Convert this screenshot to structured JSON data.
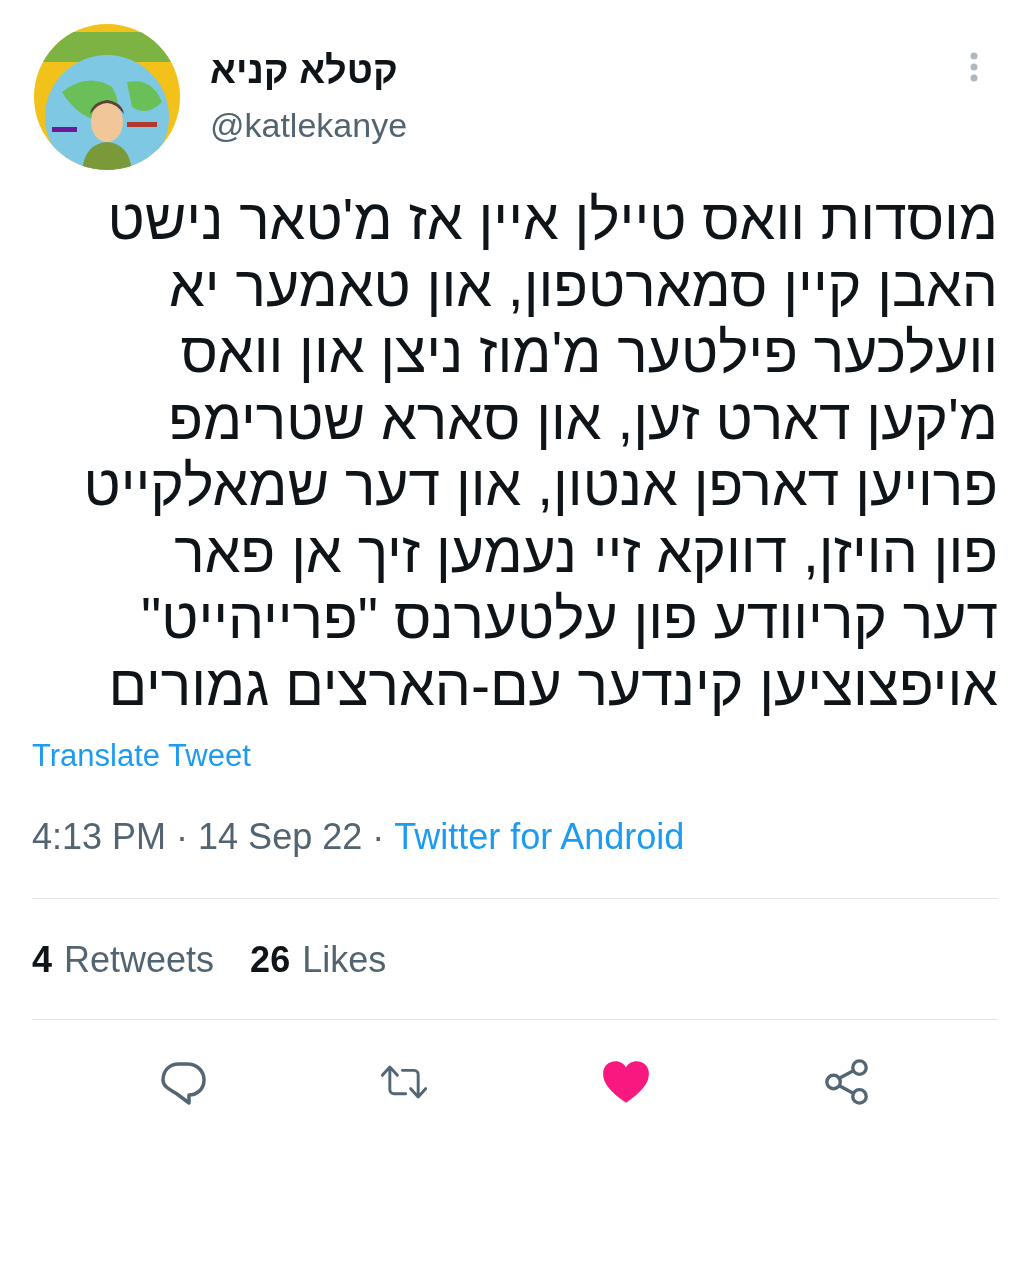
{
  "author": {
    "name": "קטלא קניא",
    "handle": "@katlekanye"
  },
  "tweet": {
    "lines": [
      "מוסדות וואס טיילן איין אז מ'טאר נישט",
      "האבן קיין סמארטפון, און טאמער יא",
      "וועלכער פילטער מ'מוז ניצן און וואס",
      "מ'קען דארט זען, און סארא שטרימפ",
      "פרויען דארפן אנטון, און דער שמאלקייט",
      "פון הויזן, דווקא זיי נעמען זיך אן פאר",
      "דער קריוודע פון עלטערנס \"פרייהייט\"",
      "אויפצוציען קינדער עם-הארצים גמורים"
    ],
    "translate": "Translate Tweet",
    "separator": "·",
    "time": "4:13 PM",
    "date": "14 Sep 22",
    "source": "Twitter for Android"
  },
  "stats": {
    "retweets": {
      "count": "4",
      "label": "Retweets"
    },
    "likes": {
      "count": "26",
      "label": "Likes"
    }
  },
  "actions": {
    "liked": true
  }
}
